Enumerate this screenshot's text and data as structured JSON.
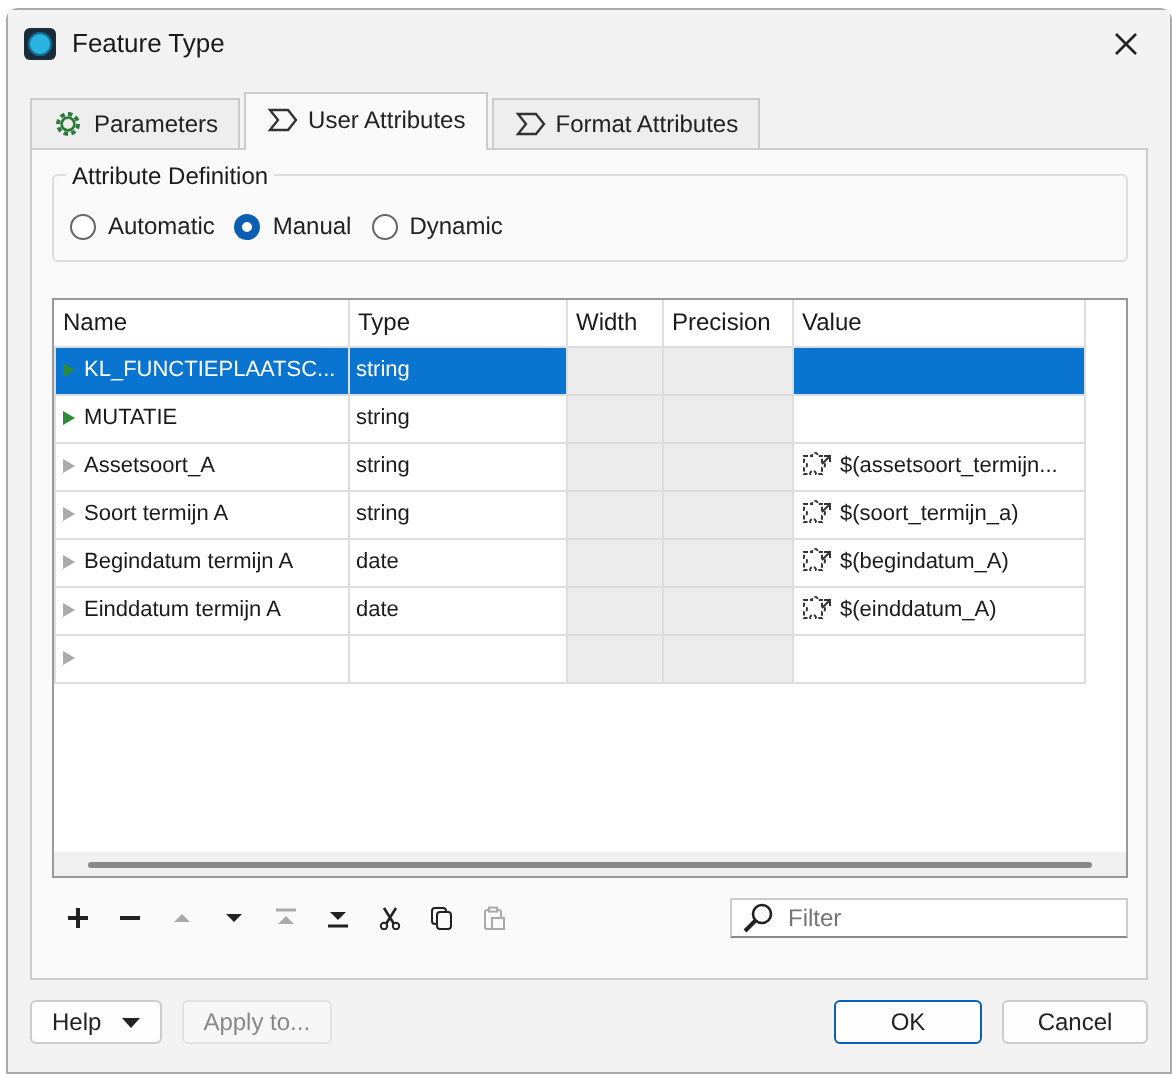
{
  "window": {
    "title": "Feature Type"
  },
  "tabs": [
    {
      "label": "Parameters",
      "selected": false
    },
    {
      "label": "User Attributes",
      "selected": true
    },
    {
      "label": "Format Attributes",
      "selected": false
    }
  ],
  "attribute_definition": {
    "title": "Attribute Definition",
    "options": [
      {
        "label": "Automatic",
        "selected": false
      },
      {
        "label": "Manual",
        "selected": true
      },
      {
        "label": "Dynamic",
        "selected": false
      }
    ]
  },
  "table": {
    "columns": [
      "Name",
      "Type",
      "Width",
      "Precision",
      "Value"
    ],
    "rows": [
      {
        "name": "KL_FUNCTIEPLAATSC...",
        "type": "string",
        "value": "",
        "color": "#2e8b3a",
        "selected": true
      },
      {
        "name": "MUTATIE",
        "type": "string",
        "value": "",
        "color": "#2e8b3a",
        "selected": false
      },
      {
        "name": "Assetsoort_A",
        "type": "string",
        "value": "$(assetsoort_termijn...",
        "color": "#aaaaaa",
        "selected": false
      },
      {
        "name": "Soort termijn A",
        "type": "string",
        "value": "$(soort_termijn_a)",
        "color": "#aaaaaa",
        "selected": false
      },
      {
        "name": "Begindatum termijn A",
        "type": "date",
        "value": "$(begindatum_A)",
        "color": "#aaaaaa",
        "selected": false
      },
      {
        "name": "Einddatum termijn A",
        "type": "date",
        "value": "$(einddatum_A)",
        "color": "#aaaaaa",
        "selected": false
      },
      {
        "name": "",
        "type": "",
        "value": "",
        "color": "#aaaaaa",
        "selected": false
      }
    ]
  },
  "toolbar": [
    {
      "kind": "add",
      "disabled": false
    },
    {
      "kind": "remove",
      "disabled": false
    },
    {
      "kind": "up",
      "disabled": true
    },
    {
      "kind": "down",
      "disabled": false
    },
    {
      "kind": "top",
      "disabled": true
    },
    {
      "kind": "bottom",
      "disabled": false
    },
    {
      "kind": "cut",
      "disabled": false
    },
    {
      "kind": "copy",
      "disabled": false
    },
    {
      "kind": "paste",
      "disabled": true
    }
  ],
  "filter": {
    "placeholder": "Filter"
  },
  "buttons": [
    {
      "label": "Help",
      "kind": "dropdown",
      "disabled": false,
      "default": false
    },
    {
      "label": "Apply to...",
      "kind": "plain",
      "disabled": true,
      "default": false
    },
    {
      "label": "OK",
      "kind": "plain",
      "disabled": false,
      "default": true
    },
    {
      "label": "Cancel",
      "kind": "plain",
      "disabled": false,
      "default": false
    }
  ]
}
